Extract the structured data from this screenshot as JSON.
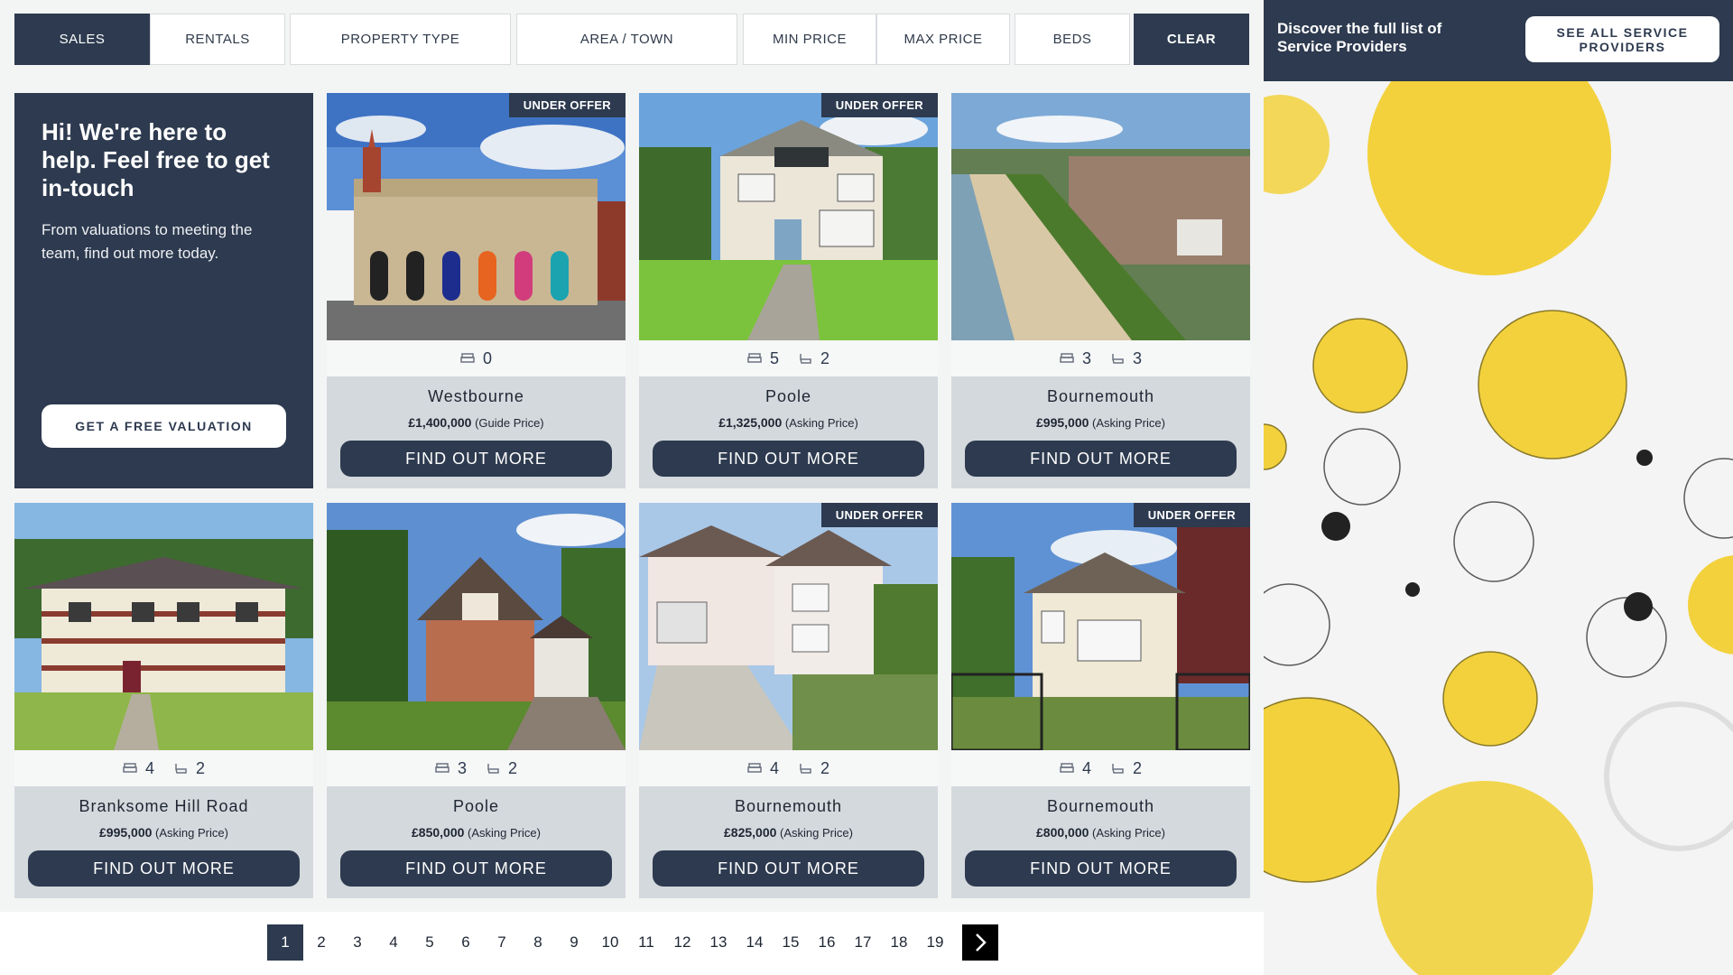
{
  "filters": {
    "sales": "SALES",
    "rentals": "RENTALS",
    "property_type": "PROPERTY TYPE",
    "area_town": "AREA / TOWN",
    "min_price": "MIN PRICE",
    "max_price": "MAX PRICE",
    "beds": "BEDS",
    "clear": "CLEAR"
  },
  "promo": {
    "heading": "Hi! We're here to help. Feel free to get in-touch",
    "body": "From valuations to meeting the team, find out more today.",
    "button": "GET A FREE VALUATION"
  },
  "listings": [
    {
      "badge": "UNDER OFFER",
      "beds": "0",
      "baths": "",
      "town": "Westbourne",
      "price": "£1,400,000",
      "qualifier": "(Guide Price)",
      "cta": "FIND OUT MORE"
    },
    {
      "badge": "UNDER OFFER",
      "beds": "5",
      "baths": "2",
      "town": "Poole",
      "price": "£1,325,000",
      "qualifier": "(Asking Price)",
      "cta": "FIND OUT MORE"
    },
    {
      "badge": "",
      "beds": "3",
      "baths": "3",
      "town": "Bournemouth",
      "price": "£995,000",
      "qualifier": "(Asking Price)",
      "cta": "FIND OUT MORE"
    },
    {
      "badge": "",
      "beds": "4",
      "baths": "2",
      "town": "Branksome Hill Road",
      "price": "£995,000",
      "qualifier": "(Asking Price)",
      "cta": "FIND OUT MORE"
    },
    {
      "badge": "",
      "beds": "3",
      "baths": "2",
      "town": "Poole",
      "price": "£850,000",
      "qualifier": "(Asking Price)",
      "cta": "FIND OUT MORE"
    },
    {
      "badge": "UNDER OFFER",
      "beds": "4",
      "baths": "2",
      "town": "Bournemouth",
      "price": "£825,000",
      "qualifier": "(Asking Price)",
      "cta": "FIND OUT MORE"
    },
    {
      "badge": "UNDER OFFER",
      "beds": "4",
      "baths": "2",
      "town": "Bournemouth",
      "price": "£800,000",
      "qualifier": "(Asking Price)",
      "cta": "FIND OUT MORE"
    }
  ],
  "pagination": {
    "current": "1",
    "pages": [
      "1",
      "2",
      "3",
      "4",
      "5",
      "6",
      "7",
      "8",
      "9",
      "10",
      "11",
      "12",
      "13",
      "14",
      "15",
      "16",
      "17",
      "18",
      "19"
    ]
  },
  "service_panel": {
    "text": "Discover the full list of Service Providers",
    "button": "SEE ALL SERVICE PROVIDERS"
  },
  "colors": {
    "navy": "#2d3a4f",
    "card_grey": "#d4d9dd",
    "accent_yellow": "#f2d13c"
  },
  "icons": {
    "bed": "bed-icon",
    "bath": "bath-icon",
    "next": "chevron-right-icon"
  }
}
